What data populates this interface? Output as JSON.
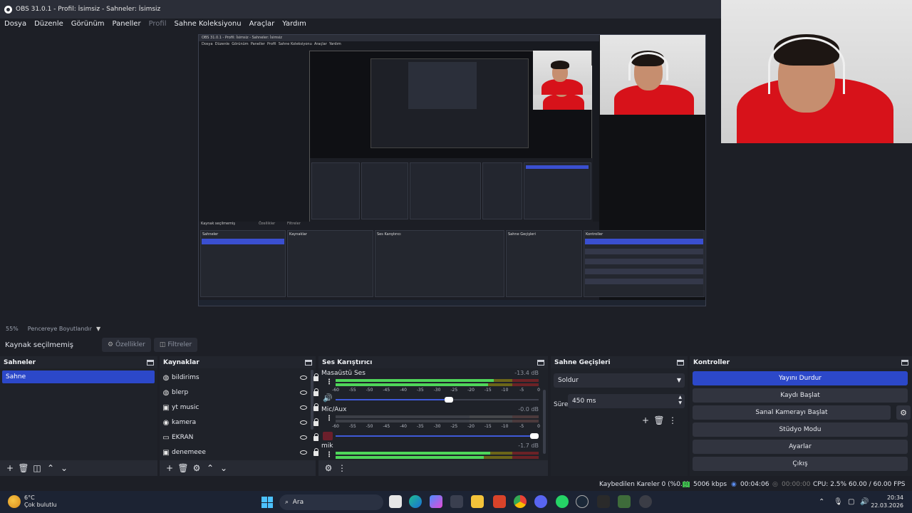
{
  "window": {
    "title": "OBS 31.0.1 - Profil: İsimsiz - Sahneler: İsimsiz"
  },
  "menu": [
    "Dosya",
    "Düzenle",
    "Görünüm",
    "Paneller",
    "Profil",
    "Sahne Koleksiyonu",
    "Araçlar",
    "Yardım"
  ],
  "nested_preview": {
    "title": "OBS 31.0.1 - Profil: İsimsiz - Sahneler: İsimsiz",
    "menu": [
      "Dosya",
      "Düzenle",
      "Görünüm",
      "Paneller",
      "Profil",
      "Sahne Koleksiyonu",
      "Araçlar",
      "Yardım"
    ],
    "source_label": "Kaynak seçilmemiş",
    "props": "Özellikler",
    "filters": "Filtreler",
    "zoom": "55%",
    "zoom_mode": "Pencereye Boyutlandır",
    "scenes_title": "Sahneler",
    "sources_title": "Kaynaklar",
    "mixer_title": "Ses Karıştırıcı",
    "transitions_title": "Sahne Geçişleri",
    "controls_title": "Kontroller",
    "scene": "Sahne",
    "sources": [
      "bildirims",
      "blerp",
      "yt music",
      "kamera",
      "EKRAN",
      "denemeee"
    ],
    "mixer": [
      {
        "name": "Masaüstü Ses",
        "db": "-13.4 dB"
      },
      {
        "name": "Mic/Aux",
        "db": "-0.0 dB"
      },
      {
        "name": "mik",
        "db": "-1.7 dB"
      }
    ],
    "transition": "Soldur",
    "duration_label": "Süre",
    "duration": "450 ms",
    "controls": [
      "Yayını Durdur",
      "Kaydı Başlat",
      "Sanal Kamerayı Başlat",
      "Stüdyo Modu",
      "Ayarlar",
      "Çıkış"
    ],
    "status": {
      "dropped": "Kaybedilen Kareler 0 (%0.0)",
      "bitrate": "5006 kbps",
      "stream_time": "00:04:06",
      "cpu": "CPU: 2.5%",
      "fps": "60.00 / 60.00 FPS"
    },
    "weather_temp": "6°C",
    "weather_desc": "Çok bulutlu",
    "search": "Ara",
    "time": "20:34",
    "date": "22.03.2026"
  },
  "zoom": {
    "level": "55%",
    "mode": "Pencereye Boyutlandır"
  },
  "source_toolbar": {
    "label": "Kaynak seçilmemiş",
    "properties": "Özellikler",
    "filters": "Filtreler"
  },
  "scenes": {
    "title": "Sahneler",
    "items": [
      "Sahne"
    ],
    "selected_index": 0
  },
  "sources": {
    "title": "Kaynaklar",
    "items": [
      {
        "label": "bildirims",
        "icon": "browser-icon"
      },
      {
        "label": "blerp",
        "icon": "browser-icon"
      },
      {
        "label": "yt music",
        "icon": "window-capture-icon"
      },
      {
        "label": "kamera",
        "icon": "camera-icon"
      },
      {
        "label": "EKRAN",
        "icon": "display-capture-icon"
      },
      {
        "label": "denemeee",
        "icon": "window-capture-icon"
      }
    ]
  },
  "mixer": {
    "title": "Ses Karıştırıcı",
    "ticks": [
      "-60",
      "-55",
      "-50",
      "-45",
      "-40",
      "-35",
      "-30",
      "-25",
      "-20",
      "-15",
      "-10",
      "-5",
      "0"
    ],
    "channels": [
      {
        "name": "Masaüstü Ses",
        "db": "-13.4 dB",
        "level": 0.78,
        "volume": 0.58,
        "muted": false
      },
      {
        "name": "Mic/Aux",
        "db": "-0.0 dB",
        "level": 0.0,
        "volume": 1.0,
        "muted": true
      },
      {
        "name": "mik",
        "db": "-1.7 dB",
        "level": 0.76,
        "volume": 1.0,
        "muted": false
      }
    ]
  },
  "transitions": {
    "title": "Sahne Geçişleri",
    "selected": "Soldur",
    "duration_label": "Süre",
    "duration": "450 ms"
  },
  "controls": {
    "title": "Kontroller",
    "stop_stream": "Yayını Durdur",
    "start_record": "Kaydı Başlat",
    "virtual_cam": "Sanal Kamerayı Başlat",
    "studio_mode": "Stüdyo Modu",
    "settings": "Ayarlar",
    "exit": "Çıkış"
  },
  "status": {
    "dropped_frames": "Kaybedilen Kareler 0 (%0.0)",
    "bitrate": "5006 kbps",
    "stream_time": "00:04:06",
    "record_time": "00:00:00",
    "cpu": "CPU: 2.5%",
    "fps": "60.00 / 60.00 FPS"
  },
  "taskbar": {
    "weather_temp": "6°C",
    "weather_desc": "Çok bulutlu",
    "search_placeholder": "Ara",
    "time": "20:34",
    "date": "22.03.2026",
    "colors": {
      "accent": "#2c48c9",
      "meter_green": "#4fd65a",
      "muted_red": "#6b1f2b"
    }
  }
}
